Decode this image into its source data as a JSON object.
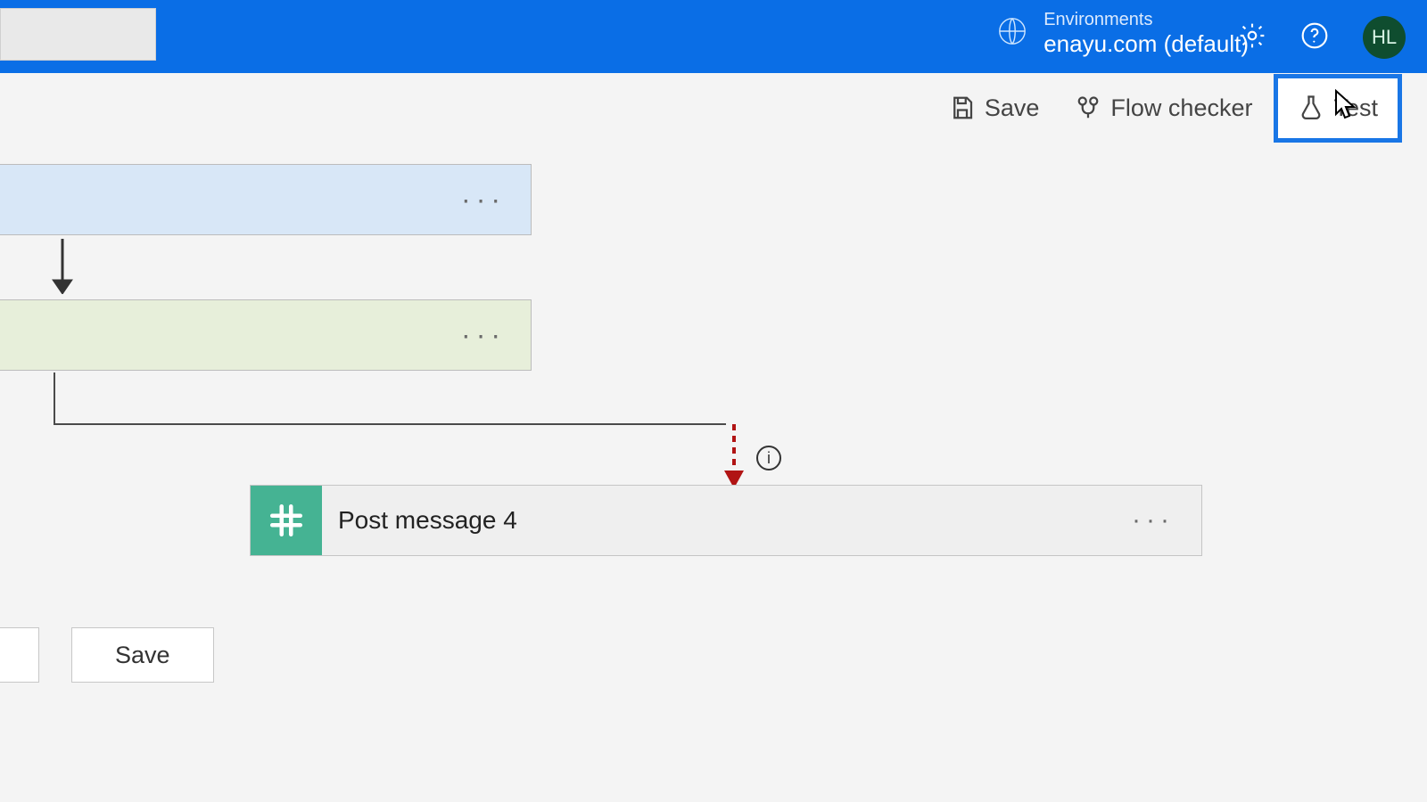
{
  "header": {
    "env_label": "Environments",
    "env_name": "enayu.com (default)",
    "avatar_initials": "HL"
  },
  "toolbar": {
    "save_label": "Save",
    "flow_checker_label": "Flow checker",
    "test_label": "Test"
  },
  "flow": {
    "action_title": "Post message 4",
    "info_symbol": "i"
  },
  "bottom": {
    "save_label": "Save"
  }
}
